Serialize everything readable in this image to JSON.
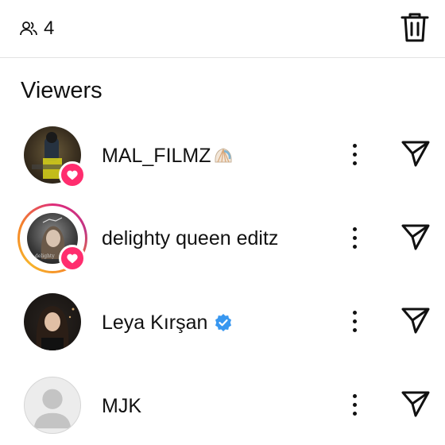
{
  "header": {
    "viewer_count": "4",
    "icons": {
      "viewers": "people-icon",
      "delete": "trash-icon"
    }
  },
  "section": {
    "title": "Viewers"
  },
  "viewers": [
    {
      "name": "MAL_FILMZ",
      "badge": "heart",
      "emoji": "shell-emoji",
      "story_ring": false
    },
    {
      "name": "delighty queen editz",
      "badge": "heart",
      "story_ring": true
    },
    {
      "name": "Leya Kırşan",
      "verified": true,
      "story_ring": false
    },
    {
      "name": "MJK",
      "default_avatar": true,
      "story_ring": false
    }
  ],
  "colors": {
    "heart_badge": "#ff2d6e",
    "verified": "#3897f0",
    "divider": "#e3e3e3"
  }
}
